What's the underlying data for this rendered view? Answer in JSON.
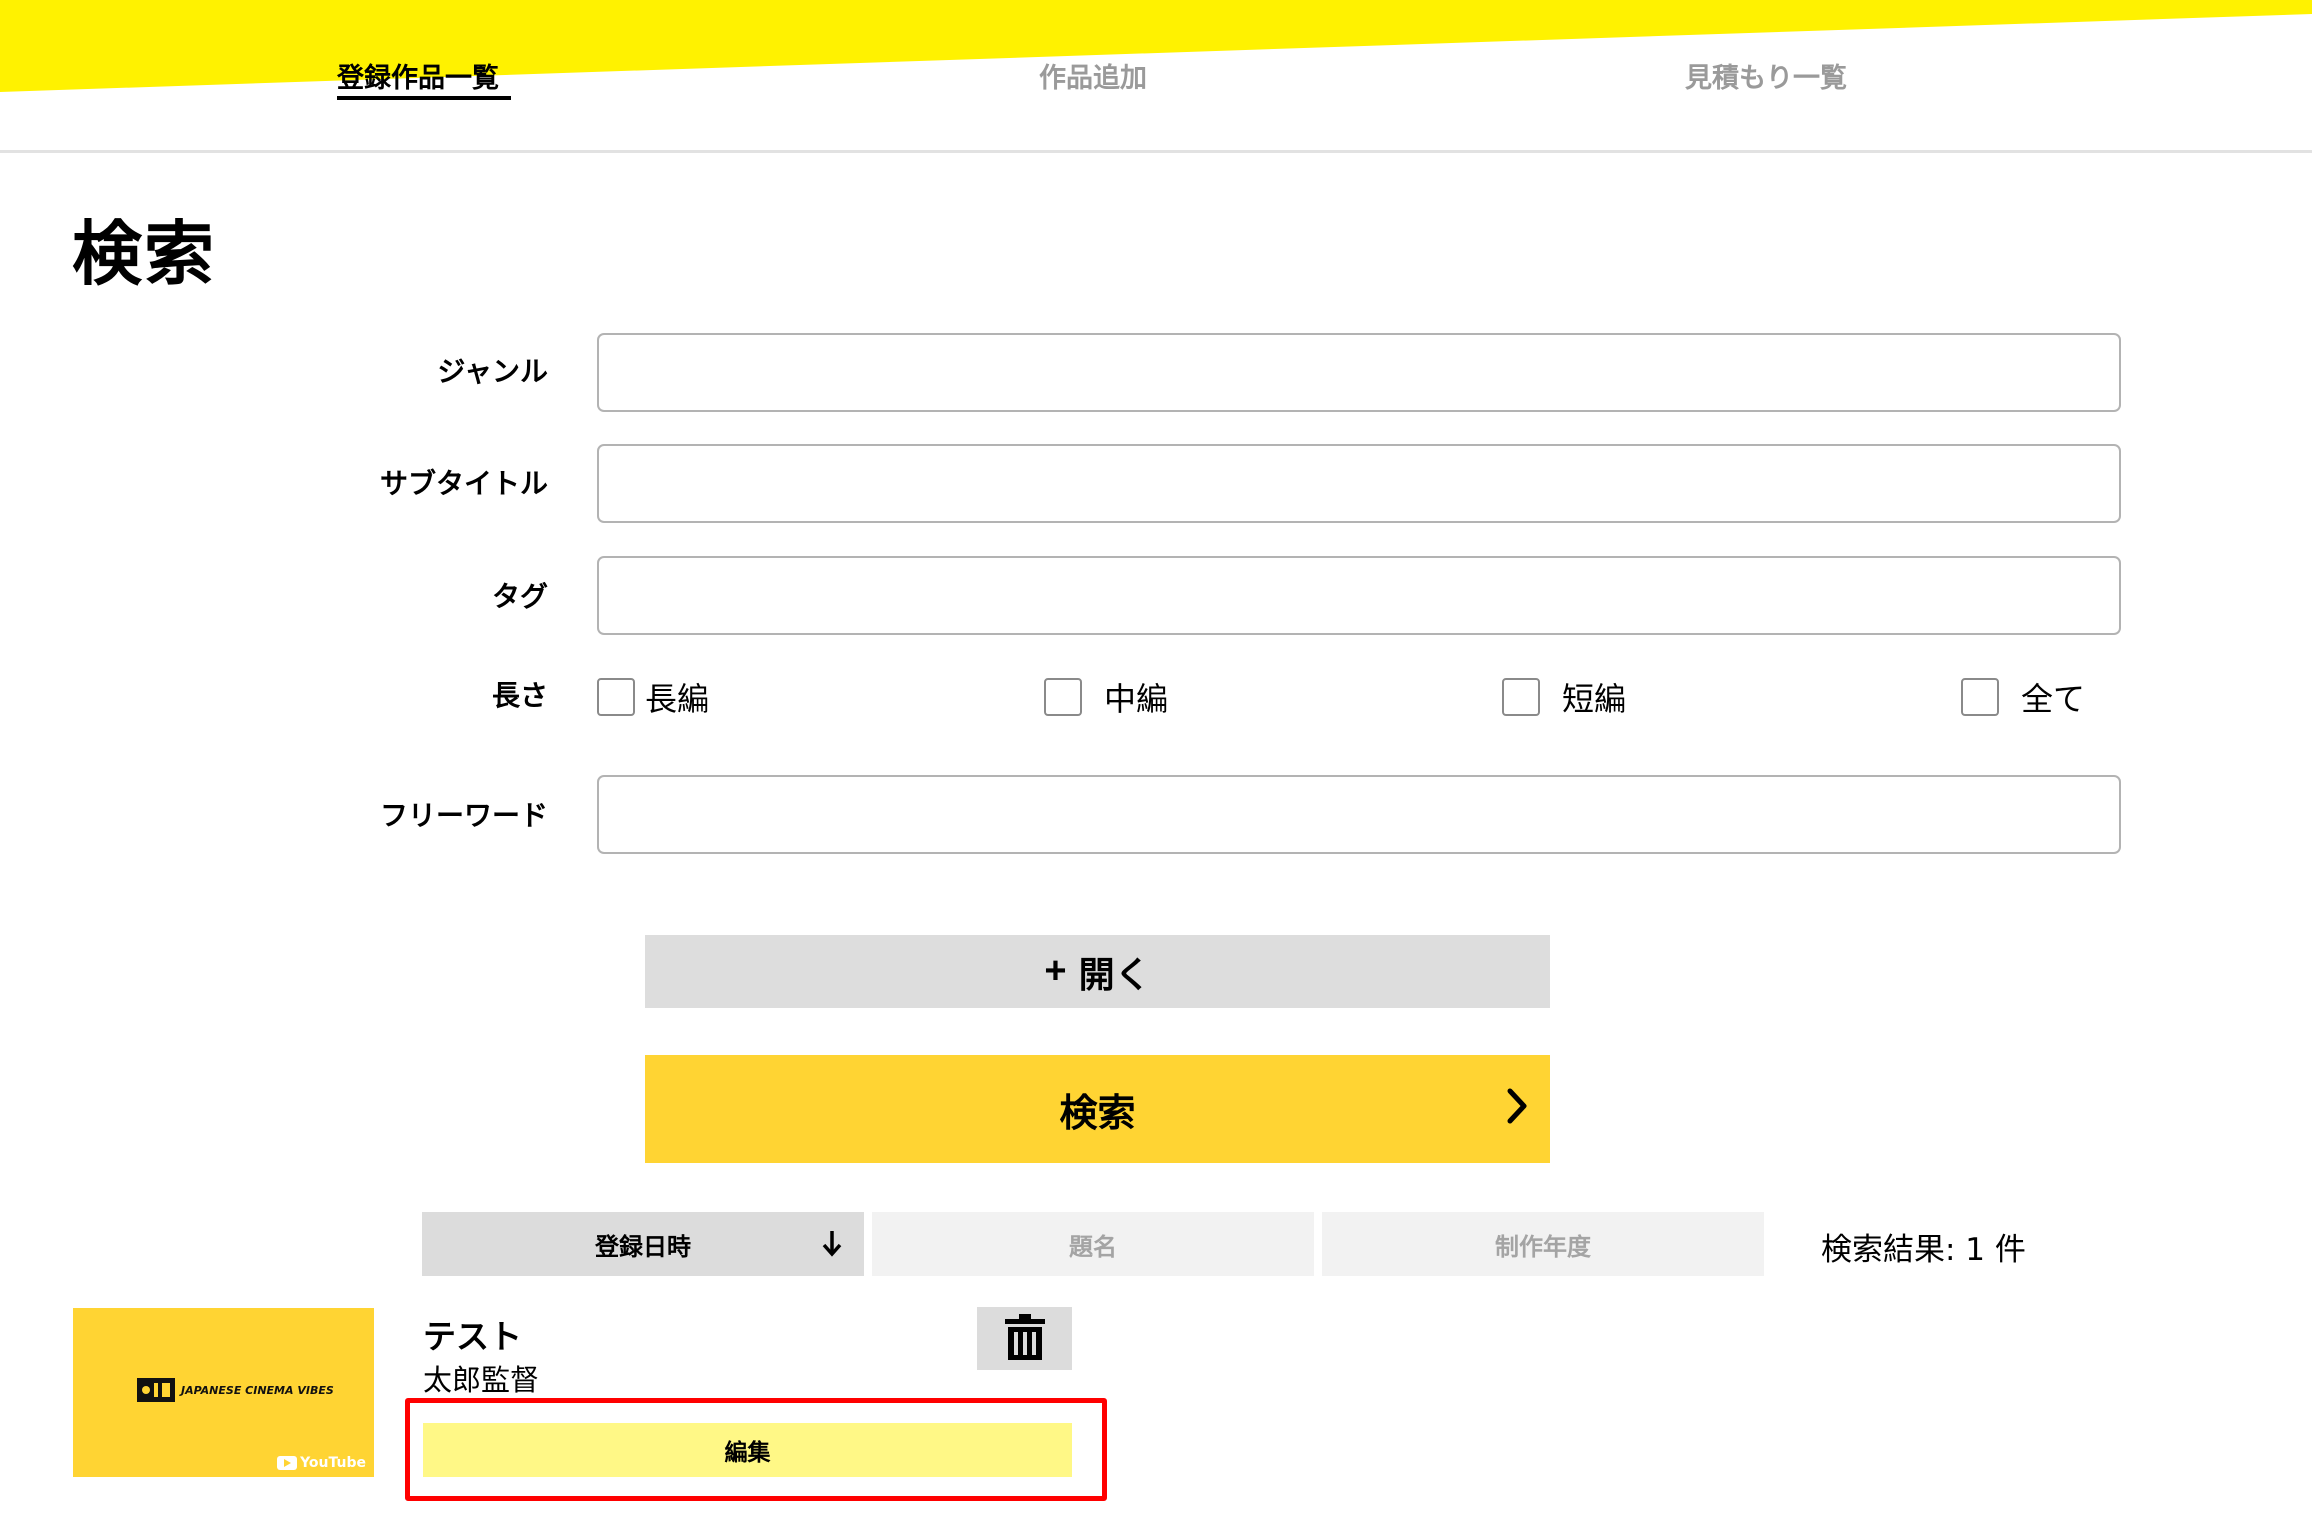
{
  "nav": {
    "tabs": [
      {
        "label": "登録作品一覧",
        "active": true
      },
      {
        "label": "作品追加",
        "active": false
      },
      {
        "label": "見積もり一覧",
        "active": false
      }
    ]
  },
  "page_title": "検索",
  "form": {
    "genre": {
      "label": "ジャンル",
      "value": ""
    },
    "subtitle": {
      "label": "サブタイトル",
      "value": ""
    },
    "tag": {
      "label": "タグ",
      "value": ""
    },
    "length": {
      "label": "長さ",
      "options": [
        {
          "label": "長編",
          "checked": false
        },
        {
          "label": "中編",
          "checked": false
        },
        {
          "label": "短編",
          "checked": false
        },
        {
          "label": "全て",
          "checked": false
        }
      ]
    },
    "freeword": {
      "label": "フリーワード",
      "value": ""
    }
  },
  "buttons": {
    "open_plus": "+",
    "open_label": "開く",
    "search_label": "検索"
  },
  "sort": {
    "tabs": [
      {
        "label": "登録日時",
        "active": true
      },
      {
        "label": "題名",
        "active": false
      },
      {
        "label": "制作年度",
        "active": false
      }
    ]
  },
  "result_count": "検索結果: 1 件",
  "results": [
    {
      "title": "テスト",
      "director": "太郎監督",
      "thumbnail_text": "JAPANESE CINEMA VIBES",
      "thumbnail_badge": "YouTube",
      "edit_label": "編集"
    }
  ],
  "colors": {
    "brand_yellow": "#fff200",
    "button_yellow": "#ffd433",
    "edit_yellow": "#fff886",
    "highlight_red": "#ff0000"
  }
}
